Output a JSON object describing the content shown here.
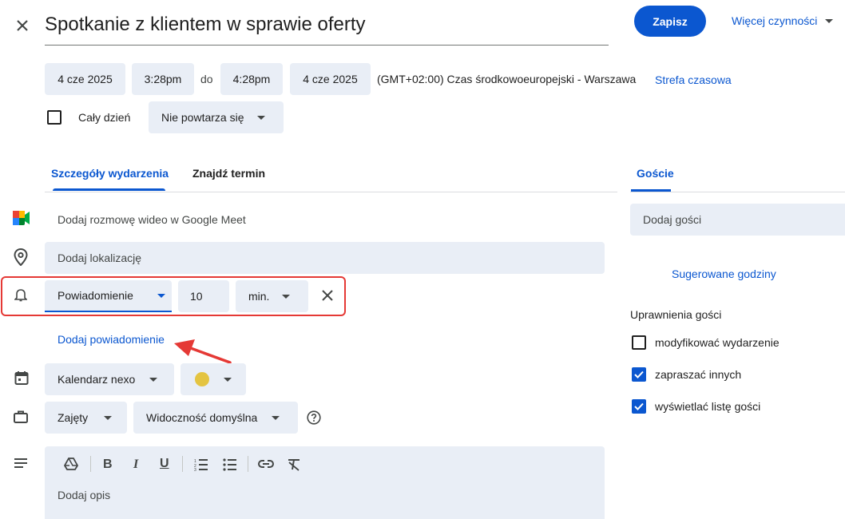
{
  "header": {
    "close_icon": "close-icon",
    "title": "Spotkanie z klientem w sprawie oferty",
    "save_label": "Zapisz",
    "more_actions_label": "Więcej czynności"
  },
  "datetime": {
    "start_date": "4 cze 2025",
    "start_time": "3:28pm",
    "to_label": "do",
    "end_time": "4:28pm",
    "end_date": "4 cze 2025",
    "timezone_text": "(GMT+02:00) Czas środkowoeuropejski - Warszawa",
    "timezone_link": "Strefa czasowa",
    "all_day_label": "Cały dzień",
    "all_day_checked": false,
    "repeat_label": "Nie powtarza się"
  },
  "tabs": {
    "details": "Szczegóły wydarzenia",
    "find_time": "Znajdź termin",
    "active": "details"
  },
  "details": {
    "meet_label": "Dodaj rozmowę wideo w Google Meet",
    "location_placeholder": "Dodaj lokalizację",
    "notification_type": "Powiadomienie",
    "notification_value": "10",
    "notification_unit": "min.",
    "add_notification": "Dodaj powiadomienie",
    "calendar_name": "Kalendarz nexo",
    "event_color": "#e4c441",
    "status_label": "Zajęty",
    "visibility_label": "Widoczność domyślna",
    "description_placeholder": "Dodaj opis"
  },
  "guests": {
    "tab_label": "Goście",
    "add_placeholder": "Dodaj gości",
    "suggested_times": "Sugerowane godziny",
    "permissions_title": "Uprawnienia gości",
    "permissions": [
      {
        "label": "modyfikować wydarzenie",
        "checked": false
      },
      {
        "label": "zapraszać innych",
        "checked": true
      },
      {
        "label": "wyświetlać listę gości",
        "checked": true
      }
    ]
  },
  "colors": {
    "accent": "#0b57d0",
    "field_bg": "#e9eef6",
    "highlight": "#e53935"
  }
}
